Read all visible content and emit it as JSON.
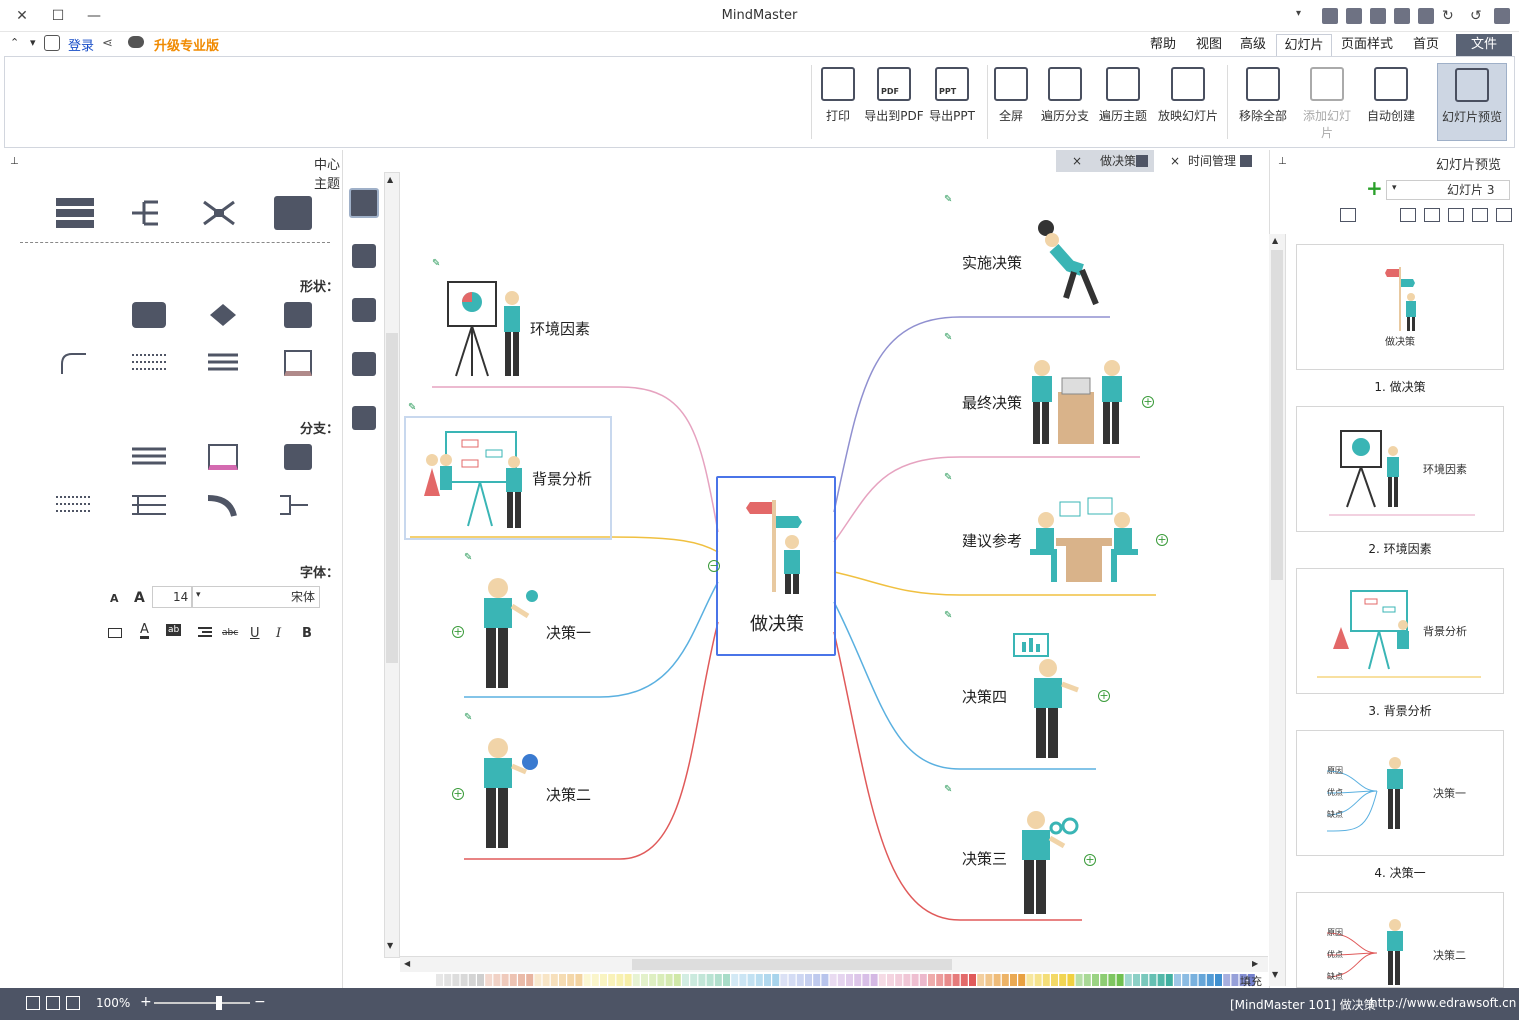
{
  "window": {
    "title": "MindMaster",
    "upgrade": "升级专业版",
    "login": "登录"
  },
  "menu": {
    "tabs": [
      "文件",
      "首页",
      "页面样式",
      "幻灯片",
      "高级",
      "视图",
      "帮助"
    ]
  },
  "ribbon": {
    "buttons": [
      "幻灯片预览",
      "自动创建",
      "添加幻灯片",
      "移除全部",
      "放映幻灯片",
      "遍历主题",
      "遍历分支",
      "全屏",
      "导出PPT",
      "导出到PDF",
      "打印"
    ],
    "icon_texts": [
      "PPT",
      "PDF"
    ]
  },
  "left_panel": {
    "title": "中心主题",
    "sections": {
      "shape": "形状：",
      "branch": "分支：",
      "font": "字体："
    },
    "font": {
      "family": "宋体",
      "size": "14",
      "grow": "A",
      "shrink": "A",
      "styles": [
        "B",
        "I",
        "U",
        "abc",
        "ab",
        "A"
      ]
    }
  },
  "doc_tabs": [
    {
      "label": "做决策",
      "active": true,
      "close": "×"
    },
    {
      "label": "时间管理",
      "active": false,
      "close": "×"
    }
  ],
  "canvas": {
    "center": "做决策",
    "left_nodes": [
      "环境因素",
      "背景分析",
      "决策一",
      "决策二"
    ],
    "right_nodes": [
      "实施决策",
      "最终决策",
      "建议参考",
      "决策四",
      "决策三"
    ],
    "fill_label": "填充"
  },
  "right_panel": {
    "title": "幻灯片预览",
    "selector": "幻灯片 3",
    "add": "+",
    "slides": [
      {
        "caption": "1. 做决策",
        "title": "做决策"
      },
      {
        "caption": "2. 环境因素",
        "title": "环境因素"
      },
      {
        "caption": "3. 背景分析",
        "title": "背景分析"
      },
      {
        "caption": "4. 决策一",
        "title": "决策一"
      },
      {
        "caption": "",
        "title": "决策二"
      }
    ],
    "slide_branch_labels": [
      "原因",
      "优点",
      "缺点"
    ]
  },
  "status": {
    "link": "http://www.edrawsoft.cn",
    "doc": "[MindMaster 101] 做决策",
    "zoom": "100%",
    "minus": "−",
    "plus": "+"
  },
  "colors": {
    "accent": "#5a6375",
    "status_bg": "#4d5465",
    "selection": "#4a74e8",
    "teal": "#3ab5b5",
    "green": "#3a9b3a",
    "upgrade": "#f08a00"
  }
}
